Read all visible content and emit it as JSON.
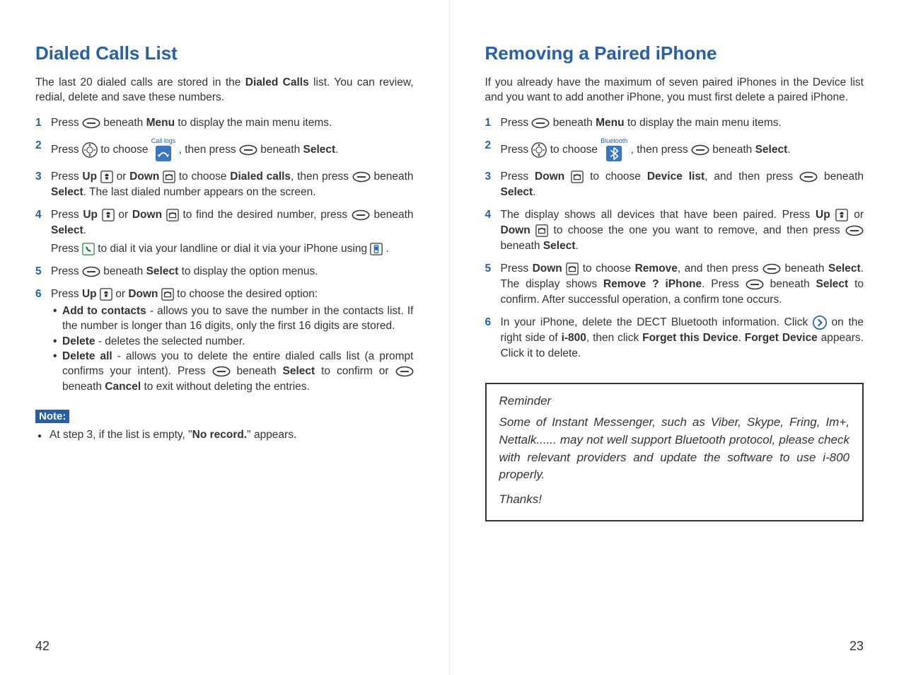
{
  "left": {
    "title": "Dialed Calls List",
    "intro_a": "The last 20 dialed calls are stored in the ",
    "intro_b": "Dialed Calls",
    "intro_c": " list. You can review, redial, delete and save these numbers.",
    "s1_a": "Press ",
    "s1_b": " beneath ",
    "s1_menu": "Menu",
    "s1_c": " to display the main menu items.",
    "s2_a": "Press ",
    "s2_b": " to choose ",
    "s2_calllogs": "Call logs",
    "s2_c": " , then press ",
    "s2_d": " beneath ",
    "s2_sel": "Select",
    "s2_e": ".",
    "s3_a": "Press ",
    "s3_up": "Up",
    "s3_or": " or ",
    "s3_down": "Down",
    "s3_b": " to choose ",
    "s3_dc": "Dialed calls",
    "s3_c": ", then press ",
    "s3_d": " beneath ",
    "s3_sel": "Select",
    "s3_e": ". The last dialed number appears on the screen.",
    "s4_a": "Press ",
    "s4_up": "Up",
    "s4_or": " or ",
    "s4_down": "Down",
    "s4_b": " to find the desired number, press ",
    "s4_c": " beneath ",
    "s4_sel": "Select",
    "s4_d": ".",
    "s4_sub_a": "Press ",
    "s4_sub_b": " to dial it via your landline or dial it via your iPhone using ",
    "s4_sub_c": " .",
    "s5_a": "Press ",
    "s5_b": " beneath ",
    "s5_sel": "Select",
    "s5_c": " to display the option menus.",
    "s6_a": "Press ",
    "s6_up": "Up",
    "s6_or": " or ",
    "s6_down": "Down",
    "s6_b": " to choose the desired option:",
    "b1_t": "Add to contacts",
    "b1_r": " - allows you to save the number in the contacts list. If the number is longer than 16 digits, only the first 16 digits are stored.",
    "b2_t": "Delete",
    "b2_r": " - deletes the selected number.",
    "b3_t": "Delete all",
    "b3_r1": " - allows you to delete the entire dialed calls list (a prompt confirms your intent). Press ",
    "b3_r2": " beneath ",
    "b3_sel": "Select",
    "b3_r3": " to confirm or ",
    "b3_r4": " beneath ",
    "b3_can": "Cancel",
    "b3_r5": " to exit without deleting the entries.",
    "note_label": "Note:",
    "note_a": "At step 3, if the list is empty, \"",
    "note_b": "No record.",
    "note_c": "\" appears.",
    "pagenum": "42"
  },
  "right": {
    "title": "Removing a Paired iPhone",
    "intro": "If you already have the maximum of seven paired iPhones in the Device list and you want to add another iPhone, you must first delete a paired iPhone.",
    "s1_a": "Press ",
    "s1_b": " beneath ",
    "s1_menu": "Menu",
    "s1_c": " to display the main menu items.",
    "s2_a": "Press ",
    "s2_b": " to choose ",
    "s2_bt": "Bluetooth",
    "s2_c": " , then press ",
    "s2_d": " beneath ",
    "s2_sel": "Select",
    "s2_e": ".",
    "s3_a": "Press ",
    "s3_down": "Down",
    "s3_b": " to choose ",
    "s3_dl": "Device list",
    "s3_c": ", and then press ",
    "s3_d": " beneath ",
    "s3_sel": "Select",
    "s3_e": ".",
    "s4_a": "The display shows all devices that have been paired. Press ",
    "s4_up": "Up",
    "s4_or": " or ",
    "s4_down": "Down",
    "s4_b": " to choose the one you want to remove, and then press ",
    "s4_c": " beneath ",
    "s4_sel": "Select",
    "s4_d": ".",
    "s5_a": "Press ",
    "s5_down": "Down",
    "s5_b": " to choose ",
    "s5_rm": "Remove",
    "s5_c": ", and then press ",
    "s5_d": " beneath ",
    "s5_sel": "Select",
    "s5_e": ". The display shows ",
    "s5_q": "Remove ? iPhone",
    "s5_f": ". Press ",
    "s5_g": " beneath ",
    "s5_sel2": "Select",
    "s5_h": " to confirm. After successful operation, a confirm tone occurs.",
    "s6_a": "In your iPhone, delete the DECT Bluetooth information. Click ",
    "s6_b": " on the right side of ",
    "s6_i800": "i-800",
    "s6_c": ", then click ",
    "s6_ftd": "Forget this Device",
    "s6_d": ". ",
    "s6_fd": "Forget Device",
    "s6_e": " appears. Click it to delete.",
    "rem_head": "Reminder",
    "rem_body": "Some of Instant Messenger, such as Viber, Skype, Fring, Im+, Nettalk...... may not well support Bluetooth protocol, please check with relevant providers and update the software to use i-800 properly.",
    "rem_thanks": "Thanks!",
    "pagenum": "23"
  }
}
